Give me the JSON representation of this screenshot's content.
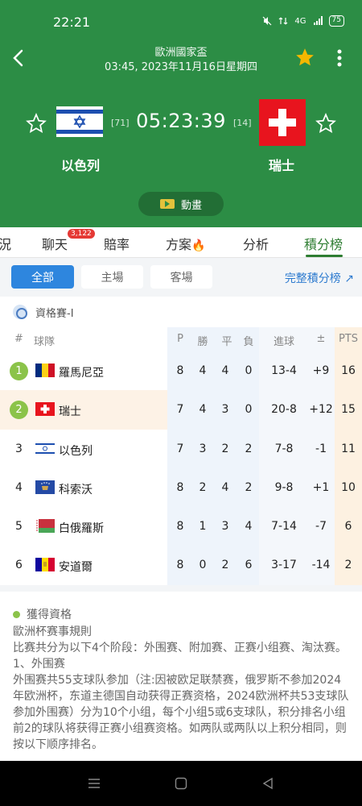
{
  "status_bar": {
    "time": "22:21",
    "battery": "75",
    "network": "4G"
  },
  "header": {
    "league": "歐洲國家盃",
    "match_date": "03:45, 2023年11月16日星期四",
    "home_team": "以色列",
    "away_team": "瑞士",
    "home_rank": "[71]",
    "away_rank": "[14]",
    "countdown": "05:23:39",
    "animation_label": "動畫",
    "star_color": "#f5b700"
  },
  "tabs": {
    "items": [
      {
        "label": "況"
      },
      {
        "label": "聊天"
      },
      {
        "label": "賠率"
      },
      {
        "label": "方案"
      },
      {
        "label": "分析"
      },
      {
        "label": "積分榜"
      }
    ],
    "chat_badge": "3,122",
    "active": "積分榜"
  },
  "filters": {
    "all": "全部",
    "home": "主場",
    "away": "客場",
    "full_table": "完整積分榜 ↗"
  },
  "group": {
    "name": "資格賽-I"
  },
  "standings": {
    "headers": {
      "rank": "#",
      "team": "球隊",
      "played": "P",
      "won": "勝",
      "draw": "平",
      "lost": "負",
      "goals": "進球",
      "diff": "±",
      "pts": "PTS"
    },
    "rows": [
      {
        "rank": "1",
        "team": "羅馬尼亞",
        "p": "8",
        "w": "4",
        "d": "4",
        "l": "0",
        "goals": "13-4",
        "diff": "+9",
        "pts": "16"
      },
      {
        "rank": "2",
        "team": "瑞士",
        "p": "7",
        "w": "4",
        "d": "3",
        "l": "0",
        "goals": "20-8",
        "diff": "+12",
        "pts": "15"
      },
      {
        "rank": "3",
        "team": "以色列",
        "p": "7",
        "w": "3",
        "d": "2",
        "l": "2",
        "goals": "7-8",
        "diff": "-1",
        "pts": "11"
      },
      {
        "rank": "4",
        "team": "科索沃",
        "p": "8",
        "w": "2",
        "d": "4",
        "l": "2",
        "goals": "9-8",
        "diff": "+1",
        "pts": "10"
      },
      {
        "rank": "5",
        "team": "白俄羅斯",
        "p": "8",
        "w": "1",
        "d": "3",
        "l": "4",
        "goals": "7-14",
        "diff": "-7",
        "pts": "6"
      },
      {
        "rank": "6",
        "team": "安道爾",
        "p": "8",
        "w": "0",
        "d": "2",
        "l": "6",
        "goals": "3-17",
        "diff": "-14",
        "pts": "2"
      }
    ]
  },
  "rules": {
    "qualify_label": "獲得資格",
    "title": "歐洲杯赛事規則",
    "line1": "比赛共分为以下4个阶段：外围赛、附加赛、正赛小组赛、淘汰赛。",
    "line2": "1、外围赛",
    "line3": "外围赛共55支球队参加（注:因被欧足联禁赛，俄罗斯不参加2024年欧洲杯，东道主德国自动获得正赛资格，2024欧洲杯共53支球队参加外围赛）分为10个小组，每个小组5或6支球队，积分排名小组前2的球队将获得正赛小组赛资格。如两队或两队以上积分相同，则按以下顺序排名。"
  }
}
